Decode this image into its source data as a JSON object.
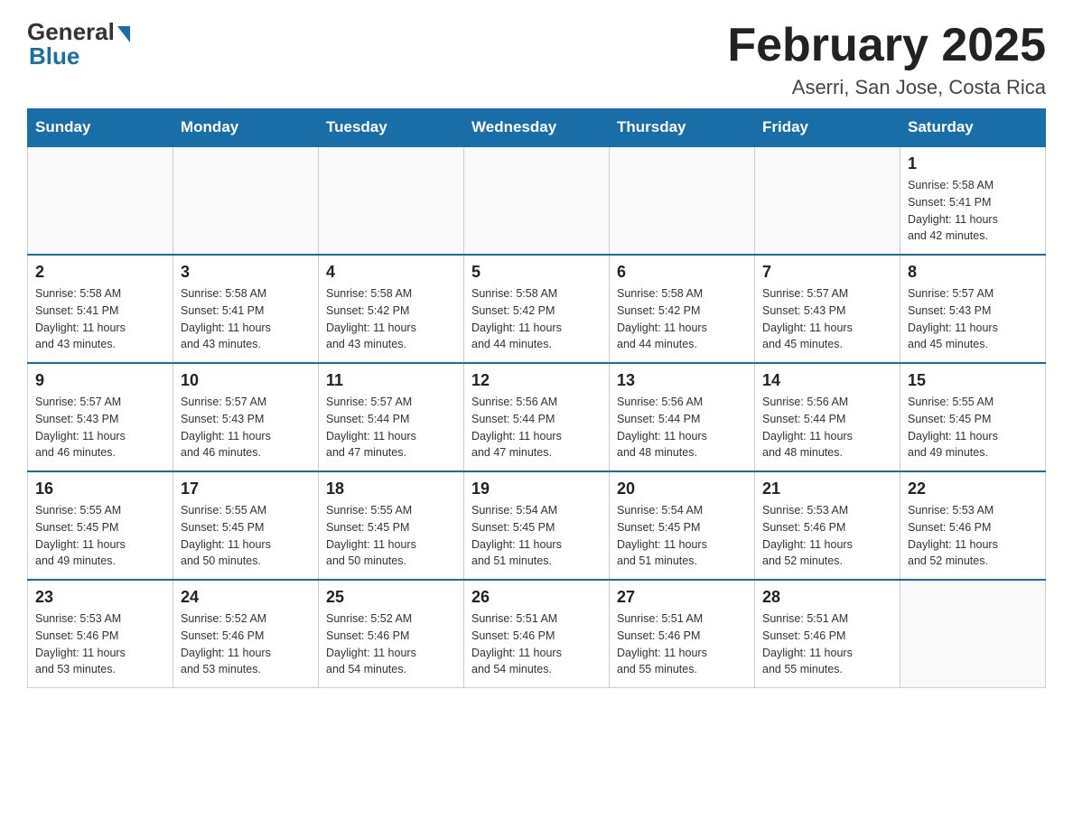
{
  "logo": {
    "general": "General",
    "blue": "Blue"
  },
  "title": "February 2025",
  "location": "Aserri, San Jose, Costa Rica",
  "weekdays": [
    "Sunday",
    "Monday",
    "Tuesday",
    "Wednesday",
    "Thursday",
    "Friday",
    "Saturday"
  ],
  "weeks": [
    [
      {
        "day": "",
        "info": ""
      },
      {
        "day": "",
        "info": ""
      },
      {
        "day": "",
        "info": ""
      },
      {
        "day": "",
        "info": ""
      },
      {
        "day": "",
        "info": ""
      },
      {
        "day": "",
        "info": ""
      },
      {
        "day": "1",
        "info": "Sunrise: 5:58 AM\nSunset: 5:41 PM\nDaylight: 11 hours\nand 42 minutes."
      }
    ],
    [
      {
        "day": "2",
        "info": "Sunrise: 5:58 AM\nSunset: 5:41 PM\nDaylight: 11 hours\nand 43 minutes."
      },
      {
        "day": "3",
        "info": "Sunrise: 5:58 AM\nSunset: 5:41 PM\nDaylight: 11 hours\nand 43 minutes."
      },
      {
        "day": "4",
        "info": "Sunrise: 5:58 AM\nSunset: 5:42 PM\nDaylight: 11 hours\nand 43 minutes."
      },
      {
        "day": "5",
        "info": "Sunrise: 5:58 AM\nSunset: 5:42 PM\nDaylight: 11 hours\nand 44 minutes."
      },
      {
        "day": "6",
        "info": "Sunrise: 5:58 AM\nSunset: 5:42 PM\nDaylight: 11 hours\nand 44 minutes."
      },
      {
        "day": "7",
        "info": "Sunrise: 5:57 AM\nSunset: 5:43 PM\nDaylight: 11 hours\nand 45 minutes."
      },
      {
        "day": "8",
        "info": "Sunrise: 5:57 AM\nSunset: 5:43 PM\nDaylight: 11 hours\nand 45 minutes."
      }
    ],
    [
      {
        "day": "9",
        "info": "Sunrise: 5:57 AM\nSunset: 5:43 PM\nDaylight: 11 hours\nand 46 minutes."
      },
      {
        "day": "10",
        "info": "Sunrise: 5:57 AM\nSunset: 5:43 PM\nDaylight: 11 hours\nand 46 minutes."
      },
      {
        "day": "11",
        "info": "Sunrise: 5:57 AM\nSunset: 5:44 PM\nDaylight: 11 hours\nand 47 minutes."
      },
      {
        "day": "12",
        "info": "Sunrise: 5:56 AM\nSunset: 5:44 PM\nDaylight: 11 hours\nand 47 minutes."
      },
      {
        "day": "13",
        "info": "Sunrise: 5:56 AM\nSunset: 5:44 PM\nDaylight: 11 hours\nand 48 minutes."
      },
      {
        "day": "14",
        "info": "Sunrise: 5:56 AM\nSunset: 5:44 PM\nDaylight: 11 hours\nand 48 minutes."
      },
      {
        "day": "15",
        "info": "Sunrise: 5:55 AM\nSunset: 5:45 PM\nDaylight: 11 hours\nand 49 minutes."
      }
    ],
    [
      {
        "day": "16",
        "info": "Sunrise: 5:55 AM\nSunset: 5:45 PM\nDaylight: 11 hours\nand 49 minutes."
      },
      {
        "day": "17",
        "info": "Sunrise: 5:55 AM\nSunset: 5:45 PM\nDaylight: 11 hours\nand 50 minutes."
      },
      {
        "day": "18",
        "info": "Sunrise: 5:55 AM\nSunset: 5:45 PM\nDaylight: 11 hours\nand 50 minutes."
      },
      {
        "day": "19",
        "info": "Sunrise: 5:54 AM\nSunset: 5:45 PM\nDaylight: 11 hours\nand 51 minutes."
      },
      {
        "day": "20",
        "info": "Sunrise: 5:54 AM\nSunset: 5:45 PM\nDaylight: 11 hours\nand 51 minutes."
      },
      {
        "day": "21",
        "info": "Sunrise: 5:53 AM\nSunset: 5:46 PM\nDaylight: 11 hours\nand 52 minutes."
      },
      {
        "day": "22",
        "info": "Sunrise: 5:53 AM\nSunset: 5:46 PM\nDaylight: 11 hours\nand 52 minutes."
      }
    ],
    [
      {
        "day": "23",
        "info": "Sunrise: 5:53 AM\nSunset: 5:46 PM\nDaylight: 11 hours\nand 53 minutes."
      },
      {
        "day": "24",
        "info": "Sunrise: 5:52 AM\nSunset: 5:46 PM\nDaylight: 11 hours\nand 53 minutes."
      },
      {
        "day": "25",
        "info": "Sunrise: 5:52 AM\nSunset: 5:46 PM\nDaylight: 11 hours\nand 54 minutes."
      },
      {
        "day": "26",
        "info": "Sunrise: 5:51 AM\nSunset: 5:46 PM\nDaylight: 11 hours\nand 54 minutes."
      },
      {
        "day": "27",
        "info": "Sunrise: 5:51 AM\nSunset: 5:46 PM\nDaylight: 11 hours\nand 55 minutes."
      },
      {
        "day": "28",
        "info": "Sunrise: 5:51 AM\nSunset: 5:46 PM\nDaylight: 11 hours\nand 55 minutes."
      },
      {
        "day": "",
        "info": ""
      }
    ]
  ]
}
